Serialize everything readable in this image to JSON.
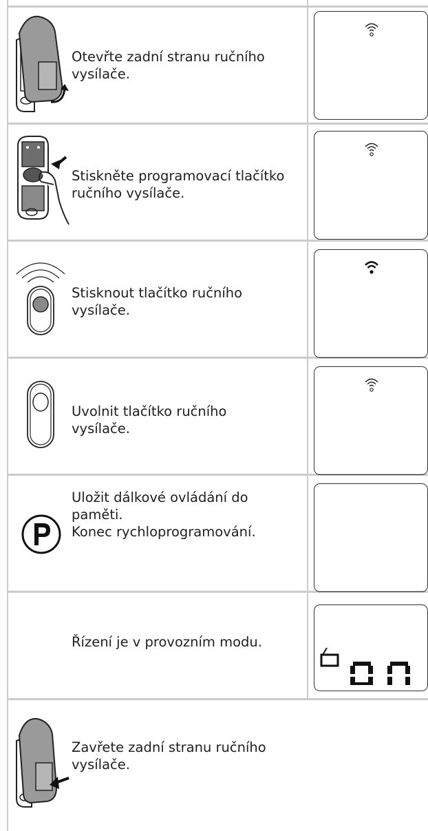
{
  "steps": [
    {
      "text": "Otevřte zadní stranu ručního\nvysílače.",
      "illustration": "remote-open-back-icon",
      "display_icon": "wifi-outline-icon"
    },
    {
      "text": "Stiskněte programovací tlačítko\nručního vysílače.",
      "illustration": "press-program-button-icon",
      "display_icon": "wifi-outline-icon"
    },
    {
      "text": "Stisknout tlačítko ručního\nvysílače.",
      "illustration": "button-transmitting-icon",
      "display_icon": "wifi-filled-icon"
    },
    {
      "text": "Uvolnit tlačítko ručního\nvysílače.",
      "illustration": "button-released-icon",
      "display_icon": "wifi-outline-icon"
    },
    {
      "text": "Uložit dálkové ovládání do\npaměti.\nKonec rychloprogramování.",
      "illustration": "p-button-icon",
      "display_icon": ""
    },
    {
      "text": "Řízení je v provozním modu.",
      "illustration": "",
      "display_icon": "door-on-display-icon"
    },
    {
      "text": "Zavřete zadní stranu ručního\nvysílače.",
      "illustration": "remote-close-back-icon",
      "display_icon": ""
    }
  ]
}
